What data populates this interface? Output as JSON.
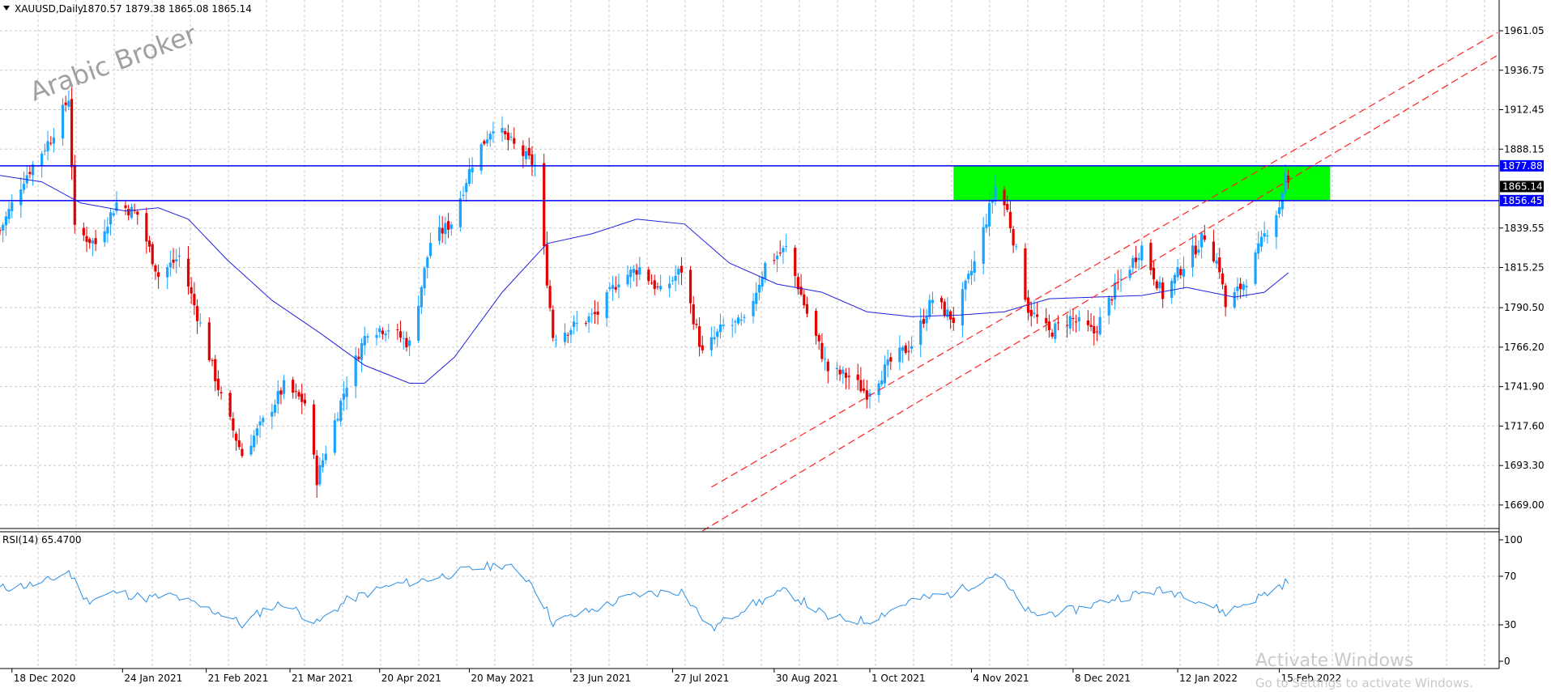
{
  "header": {
    "symbol_label": "XAUUSD,Daily",
    "ohlc": "1870.57 1879.38 1865.08 1865.14"
  },
  "watermark": "Arabic Broker",
  "activation": {
    "line1": "Activate Windows",
    "line2": "Go to Settings to activate Windows."
  },
  "colors": {
    "bull": "#1aa3ff",
    "bear": "#e30000",
    "ma": "#2020e0",
    "hline": "#0000ff",
    "zone": "#00ff00",
    "trend": "#ff2020",
    "grid": "#c8c8c8",
    "rsi": "#2b8fe6"
  },
  "chart_data": [
    {
      "type": "candlestick",
      "title": "XAUUSD,Daily",
      "ylim": [
        1655,
        1980
      ],
      "yticks": [
        "1961.05",
        "1936.75",
        "1912.45",
        "1888.15",
        "1839.55",
        "1815.25",
        "1790.50",
        "1766.20",
        "1741.90",
        "1717.60",
        "1693.30",
        "1669.00"
      ],
      "price_labels": [
        {
          "value": 1877.88,
          "label": "1877.88",
          "kind": "hline"
        },
        {
          "value": 1865.14,
          "label": "1865.14",
          "kind": "current"
        },
        {
          "value": 1856.45,
          "label": "1856.45",
          "kind": "hline"
        }
      ],
      "horizontal_lines": [
        1877.88,
        1856.45
      ],
      "zone": {
        "from_date": "2021-10-29",
        "to_date": "2022-03-04",
        "low": 1856.45,
        "high": 1877.88
      },
      "trendlines": [
        {
          "d1": "2021-08-09",
          "v1": 1680,
          "d2": "2022-04-29",
          "v2": 1960
        },
        {
          "d1": "2021-08-06",
          "v1": 1653,
          "d2": "2022-04-29",
          "v2": 1946
        }
      ],
      "xticks": [
        {
          "date": "2020-12-18",
          "label": "18 Dec 2020"
        },
        {
          "date": "2021-01-24",
          "label": "24 Jan 2021"
        },
        {
          "date": "2021-02-21",
          "label": "21 Feb 2021"
        },
        {
          "date": "2021-03-21",
          "label": "21 Mar 2021"
        },
        {
          "date": "2021-04-20",
          "label": "20 Apr 2021"
        },
        {
          "date": "2021-05-20",
          "label": "20 May 2021"
        },
        {
          "date": "2021-06-23",
          "label": "23 Jun 2021"
        },
        {
          "date": "2021-07-27",
          "label": "27 Jul 2021"
        },
        {
          "date": "2021-08-30",
          "label": "30 Aug 2021"
        },
        {
          "date": "2021-10-01",
          "label": "1 Oct 2021"
        },
        {
          "date": "2021-11-04",
          "label": "4 Nov 2021"
        },
        {
          "date": "2021-12-08",
          "label": "8 Dec 2021"
        },
        {
          "date": "2022-01-12",
          "label": "12 Jan 2022"
        },
        {
          "date": "2022-02-15",
          "label": "15 Feb 2022"
        }
      ],
      "xlim": [
        "2020-12-14",
        "2022-04-29"
      ],
      "close_path": [
        [
          "2020-12-14",
          1838
        ],
        [
          "2020-12-22",
          1870
        ],
        [
          "2020-12-31",
          1895
        ],
        [
          "2021-01-06",
          1920
        ],
        [
          "2021-01-08",
          1838
        ],
        [
          "2021-01-15",
          1830
        ],
        [
          "2021-01-22",
          1855
        ],
        [
          "2021-01-29",
          1848
        ],
        [
          "2021-02-05",
          1810
        ],
        [
          "2021-02-12",
          1822
        ],
        [
          "2021-02-19",
          1780
        ],
        [
          "2021-02-26",
          1735
        ],
        [
          "2021-03-05",
          1700
        ],
        [
          "2021-03-12",
          1720
        ],
        [
          "2021-03-19",
          1742
        ],
        [
          "2021-03-26",
          1732
        ],
        [
          "2021-03-30",
          1685
        ],
        [
          "2021-04-09",
          1744
        ],
        [
          "2021-04-16",
          1777
        ],
        [
          "2021-04-23",
          1778
        ],
        [
          "2021-04-30",
          1768
        ],
        [
          "2021-05-07",
          1831
        ],
        [
          "2021-05-14",
          1843
        ],
        [
          "2021-05-21",
          1880
        ],
        [
          "2021-05-28",
          1903
        ],
        [
          "2021-06-04",
          1890
        ],
        [
          "2021-06-11",
          1878
        ],
        [
          "2021-06-17",
          1773
        ],
        [
          "2021-06-25",
          1780
        ],
        [
          "2021-07-02",
          1787
        ],
        [
          "2021-07-09",
          1808
        ],
        [
          "2021-07-16",
          1815
        ],
        [
          "2021-07-23",
          1800
        ],
        [
          "2021-07-30",
          1814
        ],
        [
          "2021-08-06",
          1762
        ],
        [
          "2021-08-13",
          1779
        ],
        [
          "2021-08-20",
          1781
        ],
        [
          "2021-08-27",
          1817
        ],
        [
          "2021-09-03",
          1827
        ],
        [
          "2021-09-10",
          1787
        ],
        [
          "2021-09-17",
          1752
        ],
        [
          "2021-09-24",
          1748
        ],
        [
          "2021-09-30",
          1738
        ],
        [
          "2021-10-08",
          1757
        ],
        [
          "2021-10-15",
          1768
        ],
        [
          "2021-10-22",
          1796
        ],
        [
          "2021-10-29",
          1783
        ],
        [
          "2021-11-05",
          1818
        ],
        [
          "2021-11-12",
          1865
        ],
        [
          "2021-11-16",
          1850
        ],
        [
          "2021-11-23",
          1790
        ],
        [
          "2021-11-30",
          1775
        ],
        [
          "2021-12-07",
          1784
        ],
        [
          "2021-12-15",
          1775
        ],
        [
          "2021-12-22",
          1802
        ],
        [
          "2021-12-31",
          1828
        ],
        [
          "2022-01-07",
          1798
        ],
        [
          "2022-01-14",
          1817
        ],
        [
          "2022-01-21",
          1835
        ],
        [
          "2022-01-26",
          1815
        ],
        [
          "2022-01-28",
          1791
        ],
        [
          "2022-02-04",
          1808
        ],
        [
          "2022-02-10",
          1835
        ],
        [
          "2022-02-15",
          1853
        ],
        [
          "2022-02-17",
          1872
        ],
        [
          "2022-02-18",
          1865
        ]
      ],
      "ma_path": [
        [
          "2020-12-14",
          1872
        ],
        [
          "2020-12-28",
          1868
        ],
        [
          "2021-01-10",
          1855
        ],
        [
          "2021-01-25",
          1850
        ],
        [
          "2021-02-05",
          1852
        ],
        [
          "2021-02-15",
          1845
        ],
        [
          "2021-02-28",
          1820
        ],
        [
          "2021-03-15",
          1795
        ],
        [
          "2021-03-31",
          1775
        ],
        [
          "2021-04-15",
          1755
        ],
        [
          "2021-04-30",
          1744
        ],
        [
          "2021-05-05",
          1744
        ],
        [
          "2021-05-15",
          1760
        ],
        [
          "2021-05-31",
          1800
        ],
        [
          "2021-06-15",
          1830
        ],
        [
          "2021-06-30",
          1836
        ],
        [
          "2021-07-15",
          1845
        ],
        [
          "2021-07-31",
          1842
        ],
        [
          "2021-08-15",
          1818
        ],
        [
          "2021-08-31",
          1805
        ],
        [
          "2021-09-15",
          1800
        ],
        [
          "2021-09-30",
          1788
        ],
        [
          "2021-10-15",
          1785
        ],
        [
          "2021-10-31",
          1786
        ],
        [
          "2021-11-15",
          1788
        ],
        [
          "2021-11-30",
          1796
        ],
        [
          "2021-12-15",
          1797
        ],
        [
          "2021-12-31",
          1798
        ],
        [
          "2022-01-15",
          1803
        ],
        [
          "2022-01-31",
          1797
        ],
        [
          "2022-02-10",
          1800
        ],
        [
          "2022-02-18",
          1812
        ]
      ]
    },
    {
      "type": "line",
      "title": "RSI(14) 65.4700",
      "ylim": [
        0,
        100
      ],
      "yticks": [
        "100",
        "70",
        "30",
        "0"
      ],
      "rsi_path": [
        [
          "2020-12-14",
          60
        ],
        [
          "2020-12-28",
          64
        ],
        [
          "2021-01-06",
          74
        ],
        [
          "2021-01-12",
          50
        ],
        [
          "2021-01-22",
          57
        ],
        [
          "2021-02-01",
          52
        ],
        [
          "2021-02-10",
          54
        ],
        [
          "2021-02-19",
          45
        ],
        [
          "2021-02-28",
          38
        ],
        [
          "2021-03-05",
          30
        ],
        [
          "2021-03-12",
          42
        ],
        [
          "2021-03-19",
          48
        ],
        [
          "2021-03-30",
          31
        ],
        [
          "2021-04-09",
          50
        ],
        [
          "2021-04-23",
          62
        ],
        [
          "2021-05-07",
          68
        ],
        [
          "2021-05-21",
          76
        ],
        [
          "2021-06-01",
          80
        ],
        [
          "2021-06-10",
          65
        ],
        [
          "2021-06-17",
          32
        ],
        [
          "2021-06-30",
          42
        ],
        [
          "2021-07-15",
          55
        ],
        [
          "2021-07-30",
          58
        ],
        [
          "2021-08-09",
          26
        ],
        [
          "2021-08-20",
          44
        ],
        [
          "2021-09-03",
          58
        ],
        [
          "2021-09-17",
          36
        ],
        [
          "2021-09-30",
          33
        ],
        [
          "2021-10-15",
          50
        ],
        [
          "2021-10-29",
          56
        ],
        [
          "2021-11-12",
          72
        ],
        [
          "2021-11-24",
          38
        ],
        [
          "2021-12-08",
          42
        ],
        [
          "2021-12-22",
          52
        ],
        [
          "2022-01-05",
          58
        ],
        [
          "2022-01-14",
          56
        ],
        [
          "2022-01-28",
          40
        ],
        [
          "2022-02-10",
          55
        ],
        [
          "2022-02-18",
          66
        ]
      ]
    }
  ]
}
